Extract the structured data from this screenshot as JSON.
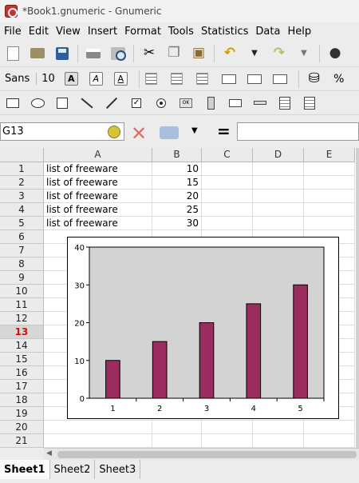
{
  "window": {
    "title": "*Book1.gnumeric - Gnumeric"
  },
  "menu": [
    "File",
    "Edit",
    "View",
    "Insert",
    "Format",
    "Tools",
    "Statistics",
    "Data",
    "Help"
  ],
  "format_bar": {
    "font_name": "Sans",
    "font_size": "10",
    "bold": "A",
    "italic": "A",
    "underline": "A"
  },
  "object_bar": {
    "button_label": "OK"
  },
  "formula_bar": {
    "cell_ref": "G13",
    "equals": "=",
    "formula": ""
  },
  "columns": [
    "A",
    "B",
    "C",
    "D",
    "E"
  ],
  "rows": [
    {
      "n": "1",
      "a": "list of freeware",
      "b": "10"
    },
    {
      "n": "2",
      "a": "list of freeware",
      "b": "15"
    },
    {
      "n": "3",
      "a": "list of freeware",
      "b": "20"
    },
    {
      "n": "4",
      "a": "list of freeware",
      "b": "25"
    },
    {
      "n": "5",
      "a": "list of freeware",
      "b": "30"
    },
    {
      "n": "6",
      "a": "",
      "b": ""
    },
    {
      "n": "7",
      "a": "",
      "b": ""
    },
    {
      "n": "8",
      "a": "",
      "b": ""
    },
    {
      "n": "9",
      "a": "",
      "b": ""
    },
    {
      "n": "10",
      "a": "",
      "b": ""
    },
    {
      "n": "11",
      "a": "",
      "b": ""
    },
    {
      "n": "12",
      "a": "",
      "b": ""
    },
    {
      "n": "13",
      "a": "",
      "b": ""
    },
    {
      "n": "14",
      "a": "",
      "b": ""
    },
    {
      "n": "15",
      "a": "",
      "b": ""
    },
    {
      "n": "16",
      "a": "",
      "b": ""
    },
    {
      "n": "17",
      "a": "",
      "b": ""
    },
    {
      "n": "18",
      "a": "",
      "b": ""
    },
    {
      "n": "19",
      "a": "",
      "b": ""
    },
    {
      "n": "20",
      "a": "",
      "b": ""
    },
    {
      "n": "21",
      "a": "",
      "b": ""
    }
  ],
  "active_row": "13",
  "chart_data": {
    "type": "bar",
    "categories": [
      "1",
      "2",
      "3",
      "4",
      "5"
    ],
    "values": [
      10,
      15,
      20,
      25,
      30
    ],
    "ylim": [
      0,
      40
    ],
    "yticks": [
      0,
      10,
      20,
      30,
      40
    ],
    "bar_color": "#9b2c5f",
    "plot_bg": "#d3d3d3",
    "grid": false,
    "legend": false
  },
  "sheets": [
    "Sheet1",
    "Sheet2",
    "Sheet3"
  ],
  "active_sheet": "Sheet1",
  "colors": {
    "active_row_header": "#cc1111",
    "selection": "#3a78c4"
  }
}
